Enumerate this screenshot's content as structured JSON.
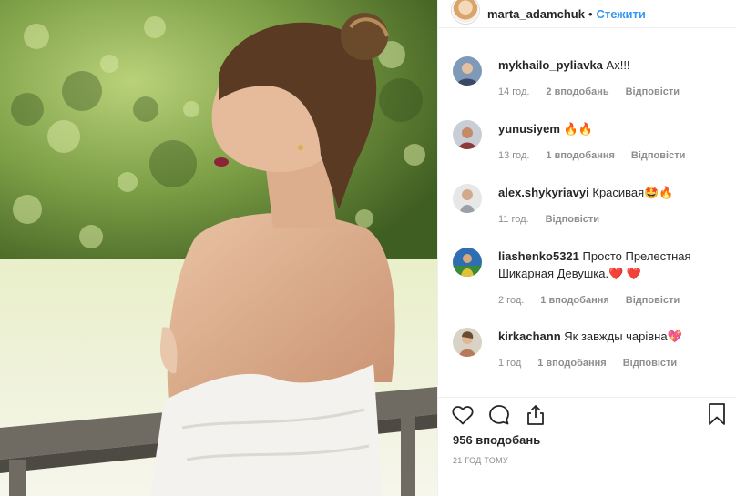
{
  "post": {
    "author": "marta_adamchuk",
    "separator": "•",
    "follow_label": "Стежити",
    "likes_text": "956 вподобань",
    "time_ago": "21 ГОД ТОМУ"
  },
  "photo": {
    "description_icon": "photo"
  },
  "comments": [
    {
      "user": "mykhailo_pyliavka",
      "text": "Ах!!!",
      "time": "14 год.",
      "likes": "2 вподобань",
      "reply": "Відповісти"
    },
    {
      "user": "yunusiyem",
      "text": "🔥🔥",
      "time": "13 год.",
      "likes": "1 вподобання",
      "reply": "Відповісти"
    },
    {
      "user": "alex.shykyriavyi",
      "text": "Красивая🤩🔥",
      "time": "11 год.",
      "likes": "",
      "reply": "Відповісти"
    },
    {
      "user": "liashenko5321",
      "text": "Просто Прелестная Шикарная Девушка.❤️ ❤️",
      "time": "2 год.",
      "likes": "1 вподобання",
      "reply": "Відповісти"
    },
    {
      "user": "kirkachann",
      "text": "Як завжды чарівна💖",
      "time": "1 год",
      "likes": "1 вподобання",
      "reply": "Відповісти"
    }
  ],
  "icons": {
    "like": "heart-icon",
    "comment": "comment-icon",
    "share": "share-icon",
    "save": "bookmark-icon"
  },
  "colors": {
    "link": "#3897f0",
    "muted": "#8e8e8e",
    "text": "#262626",
    "border": "#efefef"
  }
}
